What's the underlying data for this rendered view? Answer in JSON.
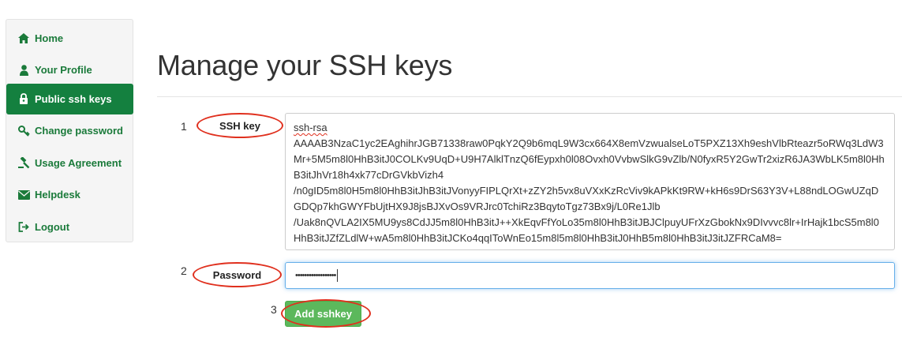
{
  "sidebar": {
    "items": [
      {
        "label": "Home",
        "icon": "home-icon"
      },
      {
        "label": "Your Profile",
        "icon": "user-icon"
      },
      {
        "label": "Public ssh keys",
        "icon": "key-lock-icon",
        "active": true
      },
      {
        "label": "Change password",
        "icon": "key-icon"
      },
      {
        "label": "Usage Agreement",
        "icon": "gavel-icon"
      },
      {
        "label": "Helpdesk",
        "icon": "envelope-icon"
      },
      {
        "label": "Logout",
        "icon": "sign-out-icon"
      }
    ]
  },
  "main": {
    "title": "Manage your SSH keys",
    "steps": {
      "one": "1",
      "two": "2",
      "three": "3"
    },
    "ssh_key_label": "SSH key",
    "ssh_key_value_first_line": "ssh-rsa",
    "ssh_key_value_rest": "AAAAB3NzaC1yc2EAghihrJGB71338raw0PqkY2Q9b6mqL9W3cx664X8emVzwualseLoT5PXZ13Xh9eshVlbRteazr5oRWq3LdW3Mr+5M5m8l0HhB3itJ0COLKv9UqD+U9H7AlklTnzQ6fEypxh0l08Ovxh0VvbwSlkG9vZlb/N0fyxR5Y2GwTr2xizR6JA3WbLK5m8l0HhB3itJhVr18h4xk77cDrGVkbVizh4\n/n0gID5m8l0H5m8l0HhB3itJhB3itJVonyyFIPLQrXt+zZY2h5vx8uVXxKzRcViv9kAPkKt9RW+kH6s9DrS63Y3V+L88ndLOGwUZqDGDQp7khGWYFbUjtHX9J8jsBJXvOs9VRJrc0TchiRz3BqytoTgz73Bx9j/L0Re1Jlb\n/Uak8nQVLA2IX5MU9ys8CdJJ5m8l0HhB3itJ++XkEqvFfYoLo35m8l0HhB3itJBJClpuyUFrXzGbokNx9DIvvvc8lr+IrHajk1bcS5m8l0HhB3itJZfZLdlW+wA5m8l0HhB3itJCKo4qqIToWnEo15m8l5m8l0HhB3itJ0HhB5m8l0HhB3itJ3itJZFRCaM8=",
    "password_label": "Password",
    "password_value": "••••••••••••••••••",
    "add_button_label": "Add sshkey"
  },
  "colors": {
    "brand_green": "#14803f",
    "button_green": "#5cb85c",
    "annotation_red": "#e0301e"
  }
}
